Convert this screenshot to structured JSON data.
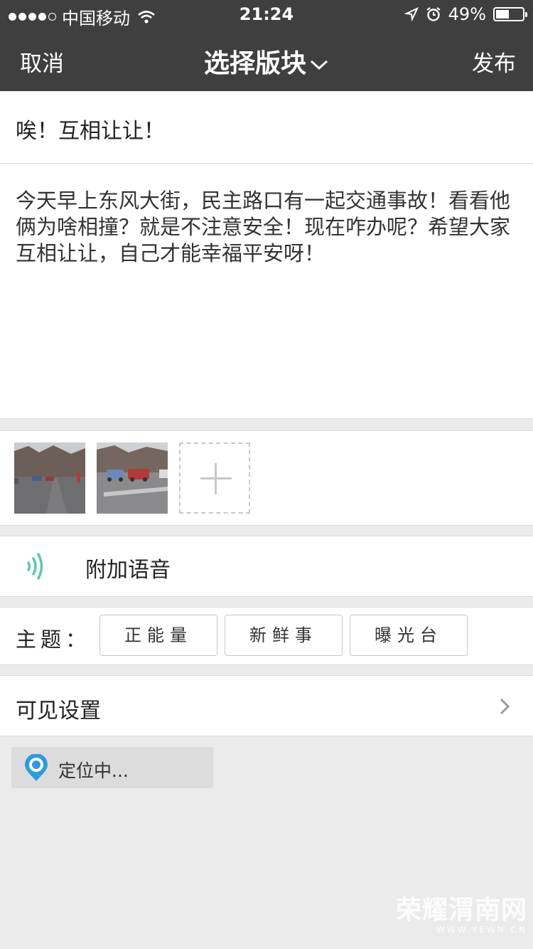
{
  "status_bar": {
    "carrier": "中国移动",
    "time": "21:24",
    "battery": "49%",
    "battery_level": 0.49
  },
  "nav": {
    "cancel_label": "取消",
    "title": "选择版块",
    "publish_label": "发布"
  },
  "post": {
    "title": "唉！互相让让！",
    "body": "今天早上东风大街，民主路口有一起交通事故！看看他俩为啥相撞？就是不注意安全！现在咋办呢？希望大家互相让让，自己才能幸福平安呀！"
  },
  "photos": {
    "count": 2
  },
  "voice": {
    "label": "附加语音"
  },
  "topic": {
    "label": "主题：",
    "tags": [
      "正能量",
      "新鲜事",
      "曝光台"
    ]
  },
  "visibility": {
    "label": "可见设置"
  },
  "location": {
    "label": "定位中..."
  },
  "watermark": {
    "main": "荣耀渭南网",
    "sub": "WWW.YEWN.CN"
  },
  "colors": {
    "bar": "#3f3f3f",
    "background": "#ebebeb",
    "voice_accent": "#5cc9a7",
    "pin_accent": "#2f9ae0"
  }
}
